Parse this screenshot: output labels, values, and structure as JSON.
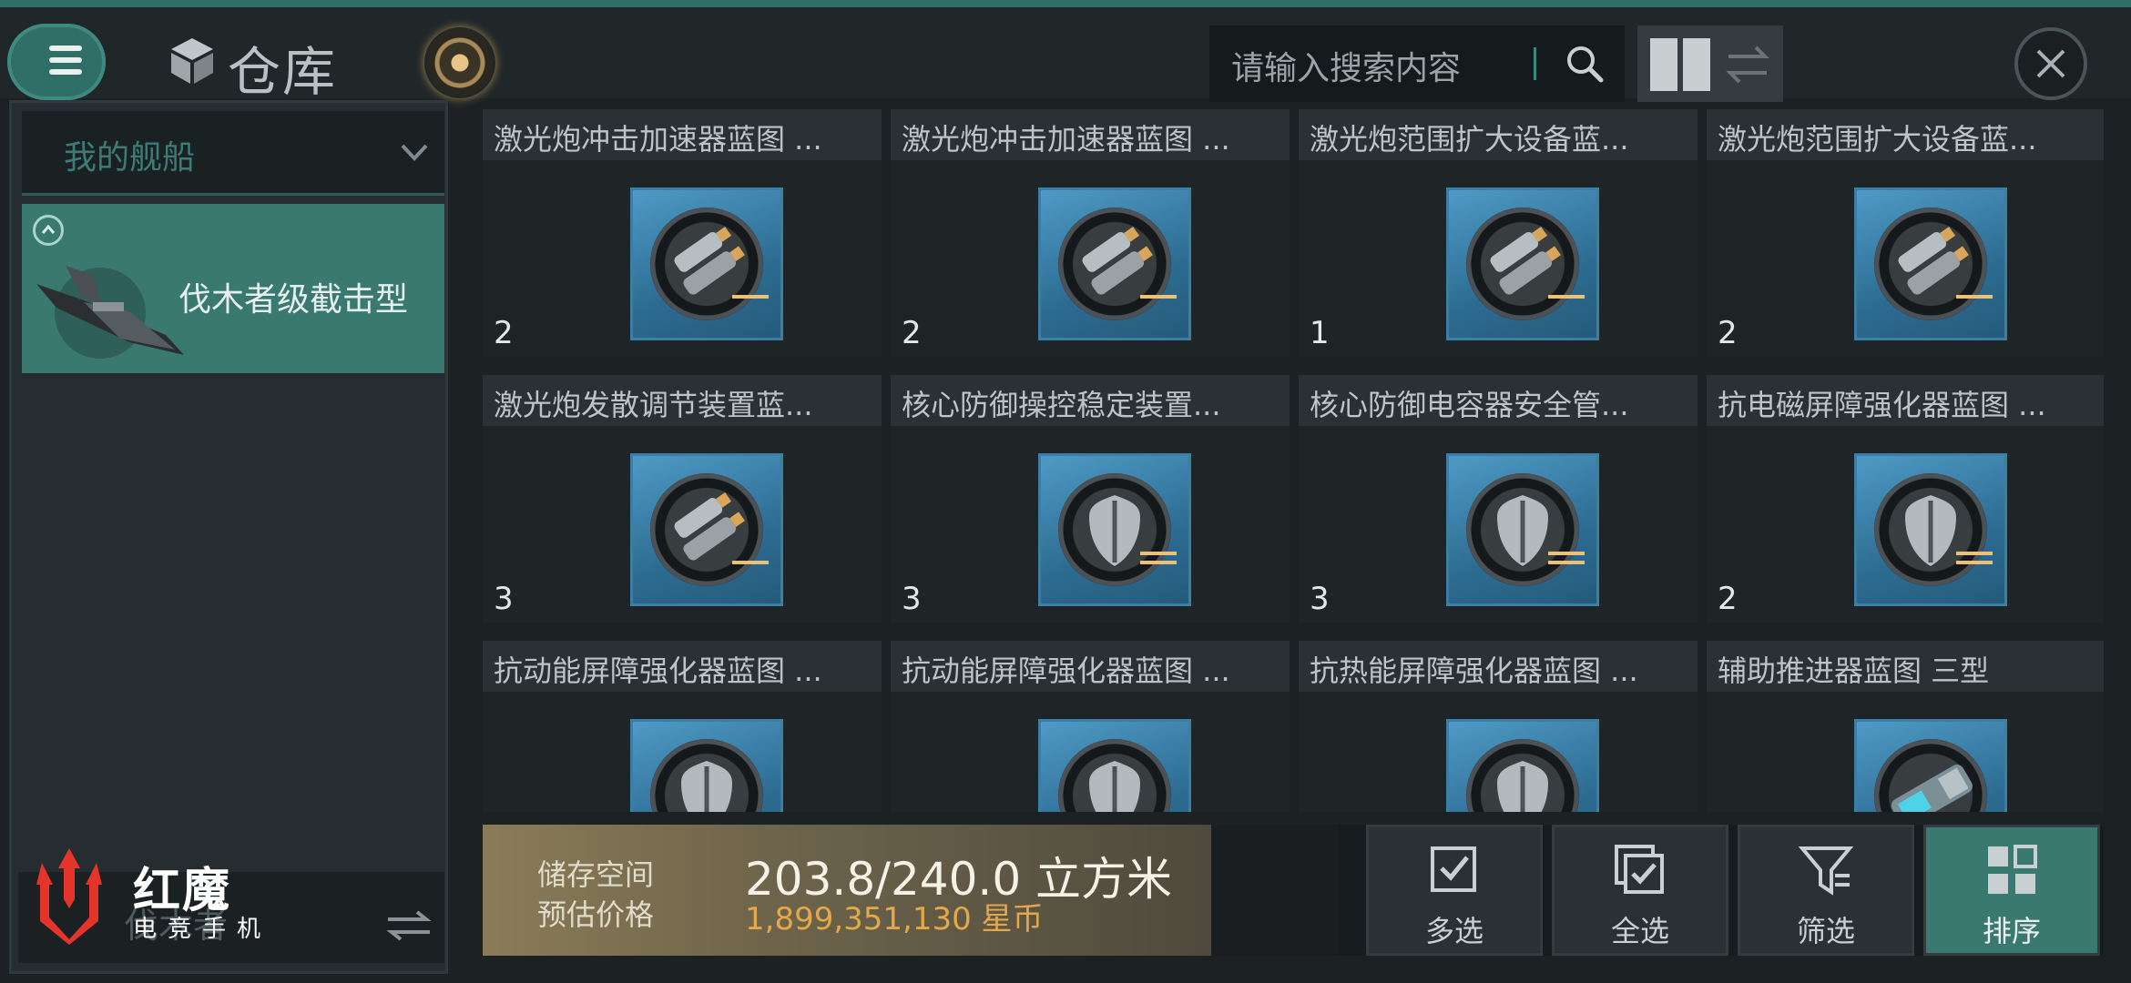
{
  "header": {
    "title": "仓库",
    "search_placeholder": "请输入搜索内容"
  },
  "sidebar": {
    "ship_dropdown_label": "我的舰船",
    "ship_name": "伐木者级截击型",
    "bottom_label": "伐木者"
  },
  "brand": {
    "name": "红魔",
    "subtitle": "电竞手机"
  },
  "items": [
    {
      "name": "激光炮冲击加速器蓝图 ...",
      "qty": "2",
      "icon": "laser-blueprint-icon"
    },
    {
      "name": "激光炮冲击加速器蓝图 ...",
      "qty": "2",
      "icon": "laser-blueprint-icon"
    },
    {
      "name": "激光炮范围扩大设备蓝...",
      "qty": "1",
      "icon": "laser-blueprint-icon"
    },
    {
      "name": "激光炮范围扩大设备蓝...",
      "qty": "2",
      "icon": "laser-blueprint-icon"
    },
    {
      "name": "激光炮发散调节装置蓝...",
      "qty": "3",
      "icon": "laser-blueprint-icon"
    },
    {
      "name": "核心防御操控稳定装置...",
      "qty": "3",
      "icon": "shield-blueprint-icon"
    },
    {
      "name": "核心防御电容器安全管...",
      "qty": "3",
      "icon": "shield-blueprint-icon"
    },
    {
      "name": "抗电磁屏障强化器蓝图 ...",
      "qty": "2",
      "icon": "shield-blueprint-icon"
    },
    {
      "name": "抗动能屏障强化器蓝图 ...",
      "qty": "",
      "icon": "shield-blueprint-icon"
    },
    {
      "name": "抗动能屏障强化器蓝图 ...",
      "qty": "",
      "icon": "shield-blueprint-icon"
    },
    {
      "name": "抗热能屏障强化器蓝图 ...",
      "qty": "",
      "icon": "shield-blueprint-icon"
    },
    {
      "name": "辅助推进器蓝图 三型",
      "qty": "",
      "icon": "thruster-blueprint-icon"
    }
  ],
  "storage": {
    "space_label": "储存空间",
    "space_value": "203.8/240.0 立方米",
    "price_label": "预估价格",
    "price_value": "1,899,351,130 星币"
  },
  "actions": [
    {
      "label": "多选",
      "icon": "multi-select-icon"
    },
    {
      "label": "全选",
      "icon": "select-all-icon"
    },
    {
      "label": "筛选",
      "icon": "filter-icon"
    },
    {
      "label": "排序",
      "icon": "sort-icon",
      "active": true
    }
  ],
  "colors": {
    "accent": "#3a7970",
    "panel": "#262d30",
    "price": "#e3a84a",
    "storage_gold": "#8a7c57"
  }
}
